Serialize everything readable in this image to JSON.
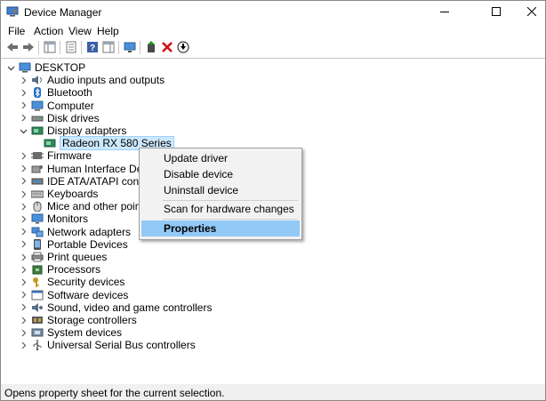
{
  "window": {
    "title": "Device Manager"
  },
  "menubar": {
    "items": [
      "File",
      "Action",
      "View",
      "Help"
    ]
  },
  "toolbar": {
    "buttons": [
      "back-arrow-icon",
      "forward-arrow-icon",
      "show-hide-tree-icon",
      "properties-sheet-icon",
      "help-icon",
      "action-pane-icon",
      "monitor-icon",
      "update-driver-icon",
      "uninstall-x-icon",
      "enable-device-icon"
    ]
  },
  "tree": {
    "root": "DESKTOP",
    "items": [
      {
        "label": "Audio inputs and outputs",
        "icon": "speaker-icon"
      },
      {
        "label": "Bluetooth",
        "icon": "bluetooth-icon"
      },
      {
        "label": "Computer",
        "icon": "computer-icon"
      },
      {
        "label": "Disk drives",
        "icon": "disk-drive-icon"
      },
      {
        "label": "Display adapters",
        "icon": "display-adapter-icon",
        "expanded": true,
        "children": [
          {
            "label": "Radeon RX 580 Series",
            "icon": "display-adapter-icon"
          }
        ]
      },
      {
        "label": "Firmware",
        "icon": "firmware-icon"
      },
      {
        "label": "Human Interface Devices",
        "icon": "hid-icon"
      },
      {
        "label": "IDE ATA/ATAPI controller",
        "icon": "ide-controller-icon"
      },
      {
        "label": "Keyboards",
        "icon": "keyboard-icon"
      },
      {
        "label": "Mice and other pointing",
        "icon": "mouse-icon"
      },
      {
        "label": "Monitors",
        "icon": "monitor-icon"
      },
      {
        "label": "Network adapters",
        "icon": "network-adapter-icon"
      },
      {
        "label": "Portable Devices",
        "icon": "portable-device-icon"
      },
      {
        "label": "Print queues",
        "icon": "printer-icon"
      },
      {
        "label": "Processors",
        "icon": "processor-icon"
      },
      {
        "label": "Security devices",
        "icon": "security-key-icon"
      },
      {
        "label": "Software devices",
        "icon": "software-device-icon"
      },
      {
        "label": "Sound, video and game controllers",
        "icon": "sound-icon"
      },
      {
        "label": "Storage controllers",
        "icon": "storage-controller-icon"
      },
      {
        "label": "System devices",
        "icon": "system-device-icon"
      },
      {
        "label": "Universal Serial Bus controllers",
        "icon": "usb-icon"
      }
    ]
  },
  "context_menu": {
    "items": [
      "Update driver",
      "Disable device",
      "Uninstall device",
      "Scan for hardware changes",
      "Properties"
    ],
    "highlighted": "Properties"
  },
  "statusbar": {
    "text": "Opens property sheet for the current selection."
  },
  "colors": {
    "selection_bg": "#cce8ff",
    "menu_highlight": "#91c9f7",
    "accent_blue": "#1e6fc2",
    "delete_red": "#d01010"
  }
}
